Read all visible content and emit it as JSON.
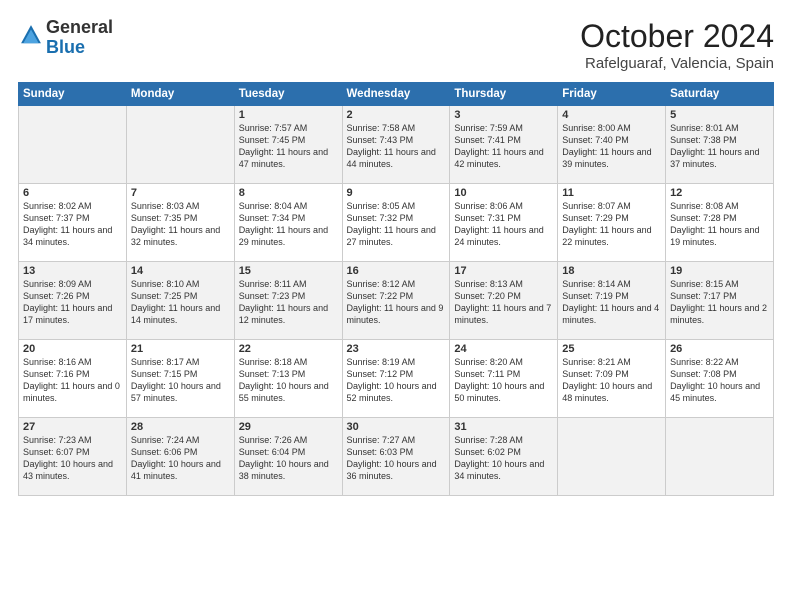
{
  "logo": {
    "line1": "General",
    "line2": "Blue"
  },
  "title": "October 2024",
  "subtitle": "Rafelguaraf, Valencia, Spain",
  "days_of_week": [
    "Sunday",
    "Monday",
    "Tuesday",
    "Wednesday",
    "Thursday",
    "Friday",
    "Saturday"
  ],
  "weeks": [
    [
      {
        "day": "",
        "info": ""
      },
      {
        "day": "",
        "info": ""
      },
      {
        "day": "1",
        "info": "Sunrise: 7:57 AM\nSunset: 7:45 PM\nDaylight: 11 hours and 47 minutes."
      },
      {
        "day": "2",
        "info": "Sunrise: 7:58 AM\nSunset: 7:43 PM\nDaylight: 11 hours and 44 minutes."
      },
      {
        "day": "3",
        "info": "Sunrise: 7:59 AM\nSunset: 7:41 PM\nDaylight: 11 hours and 42 minutes."
      },
      {
        "day": "4",
        "info": "Sunrise: 8:00 AM\nSunset: 7:40 PM\nDaylight: 11 hours and 39 minutes."
      },
      {
        "day": "5",
        "info": "Sunrise: 8:01 AM\nSunset: 7:38 PM\nDaylight: 11 hours and 37 minutes."
      }
    ],
    [
      {
        "day": "6",
        "info": "Sunrise: 8:02 AM\nSunset: 7:37 PM\nDaylight: 11 hours and 34 minutes."
      },
      {
        "day": "7",
        "info": "Sunrise: 8:03 AM\nSunset: 7:35 PM\nDaylight: 11 hours and 32 minutes."
      },
      {
        "day": "8",
        "info": "Sunrise: 8:04 AM\nSunset: 7:34 PM\nDaylight: 11 hours and 29 minutes."
      },
      {
        "day": "9",
        "info": "Sunrise: 8:05 AM\nSunset: 7:32 PM\nDaylight: 11 hours and 27 minutes."
      },
      {
        "day": "10",
        "info": "Sunrise: 8:06 AM\nSunset: 7:31 PM\nDaylight: 11 hours and 24 minutes."
      },
      {
        "day": "11",
        "info": "Sunrise: 8:07 AM\nSunset: 7:29 PM\nDaylight: 11 hours and 22 minutes."
      },
      {
        "day": "12",
        "info": "Sunrise: 8:08 AM\nSunset: 7:28 PM\nDaylight: 11 hours and 19 minutes."
      }
    ],
    [
      {
        "day": "13",
        "info": "Sunrise: 8:09 AM\nSunset: 7:26 PM\nDaylight: 11 hours and 17 minutes."
      },
      {
        "day": "14",
        "info": "Sunrise: 8:10 AM\nSunset: 7:25 PM\nDaylight: 11 hours and 14 minutes."
      },
      {
        "day": "15",
        "info": "Sunrise: 8:11 AM\nSunset: 7:23 PM\nDaylight: 11 hours and 12 minutes."
      },
      {
        "day": "16",
        "info": "Sunrise: 8:12 AM\nSunset: 7:22 PM\nDaylight: 11 hours and 9 minutes."
      },
      {
        "day": "17",
        "info": "Sunrise: 8:13 AM\nSunset: 7:20 PM\nDaylight: 11 hours and 7 minutes."
      },
      {
        "day": "18",
        "info": "Sunrise: 8:14 AM\nSunset: 7:19 PM\nDaylight: 11 hours and 4 minutes."
      },
      {
        "day": "19",
        "info": "Sunrise: 8:15 AM\nSunset: 7:17 PM\nDaylight: 11 hours and 2 minutes."
      }
    ],
    [
      {
        "day": "20",
        "info": "Sunrise: 8:16 AM\nSunset: 7:16 PM\nDaylight: 11 hours and 0 minutes."
      },
      {
        "day": "21",
        "info": "Sunrise: 8:17 AM\nSunset: 7:15 PM\nDaylight: 10 hours and 57 minutes."
      },
      {
        "day": "22",
        "info": "Sunrise: 8:18 AM\nSunset: 7:13 PM\nDaylight: 10 hours and 55 minutes."
      },
      {
        "day": "23",
        "info": "Sunrise: 8:19 AM\nSunset: 7:12 PM\nDaylight: 10 hours and 52 minutes."
      },
      {
        "day": "24",
        "info": "Sunrise: 8:20 AM\nSunset: 7:11 PM\nDaylight: 10 hours and 50 minutes."
      },
      {
        "day": "25",
        "info": "Sunrise: 8:21 AM\nSunset: 7:09 PM\nDaylight: 10 hours and 48 minutes."
      },
      {
        "day": "26",
        "info": "Sunrise: 8:22 AM\nSunset: 7:08 PM\nDaylight: 10 hours and 45 minutes."
      }
    ],
    [
      {
        "day": "27",
        "info": "Sunrise: 7:23 AM\nSunset: 6:07 PM\nDaylight: 10 hours and 43 minutes."
      },
      {
        "day": "28",
        "info": "Sunrise: 7:24 AM\nSunset: 6:06 PM\nDaylight: 10 hours and 41 minutes."
      },
      {
        "day": "29",
        "info": "Sunrise: 7:26 AM\nSunset: 6:04 PM\nDaylight: 10 hours and 38 minutes."
      },
      {
        "day": "30",
        "info": "Sunrise: 7:27 AM\nSunset: 6:03 PM\nDaylight: 10 hours and 36 minutes."
      },
      {
        "day": "31",
        "info": "Sunrise: 7:28 AM\nSunset: 6:02 PM\nDaylight: 10 hours and 34 minutes."
      },
      {
        "day": "",
        "info": ""
      },
      {
        "day": "",
        "info": ""
      }
    ]
  ]
}
